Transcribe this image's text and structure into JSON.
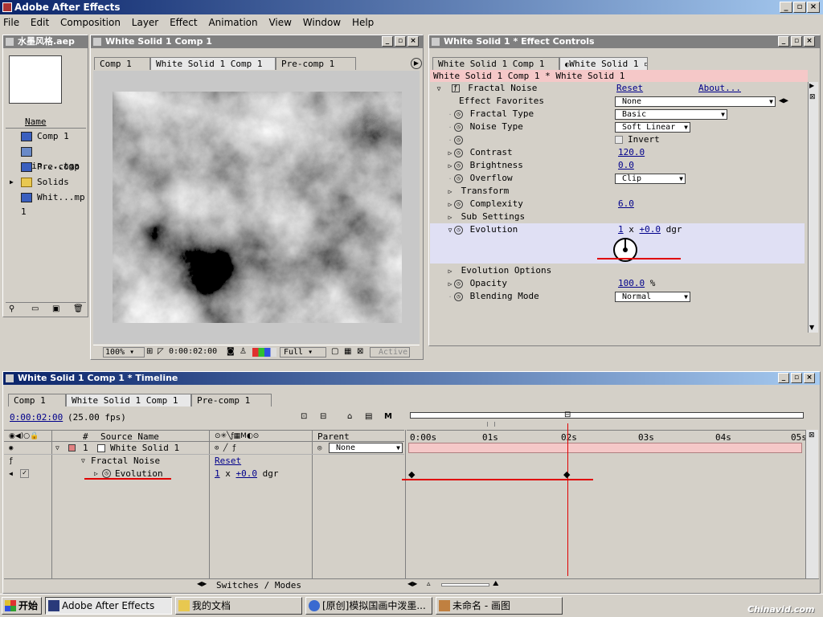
{
  "app": {
    "title": "Adobe After Effects"
  },
  "menu": [
    "File",
    "Edit",
    "Composition",
    "Layer",
    "Effect",
    "Animation",
    "View",
    "Window",
    "Help"
  ],
  "project": {
    "title": "水墨风格.aep",
    "column": "Name",
    "items": [
      {
        "label": "Comp 1",
        "icon": "comp-icon"
      },
      {
        "label": "Pain....tga",
        "icon": "image-icon"
      },
      {
        "label": "Pre-comp 1",
        "icon": "comp-icon"
      },
      {
        "label": "Solids",
        "icon": "folder-icon"
      },
      {
        "label": "Whit...mp 1",
        "icon": "comp-icon"
      }
    ]
  },
  "comp": {
    "title": "White Solid 1 Comp 1",
    "tabs": [
      "Comp 1",
      "White Solid 1 Comp 1",
      "Pre-comp 1"
    ],
    "zoom": "100%",
    "time": "0:00:02:00",
    "resolution": "Full",
    "active": "Active"
  },
  "effects": {
    "title": "White Solid 1 * Effect Controls",
    "tabs": [
      "White Solid 1 Comp 1",
      "White Solid 1"
    ],
    "path": "White Solid 1 Comp 1 * White Solid 1",
    "effect_name": "Fractal Noise",
    "reset": "Reset",
    "about": "About...",
    "rows": {
      "favorites": {
        "label": "Effect Favorites",
        "value": "None"
      },
      "fractal_type": {
        "label": "Fractal Type",
        "value": "Basic"
      },
      "noise_type": {
        "label": "Noise Type",
        "value": "Soft Linear"
      },
      "invert": {
        "label": "Invert"
      },
      "contrast": {
        "label": "Contrast",
        "value": "120.0"
      },
      "brightness": {
        "label": "Brightness",
        "value": "0.0"
      },
      "overflow": {
        "label": "Overflow",
        "value": "Clip"
      },
      "transform": {
        "label": "Transform"
      },
      "complexity": {
        "label": "Complexity",
        "value": "6.0"
      },
      "sub_settings": {
        "label": "Sub Settings"
      },
      "evolution": {
        "label": "Evolution",
        "rev": "1",
        "angle": "+0.0",
        "unit": "dgr"
      },
      "evolution_options": {
        "label": "Evolution Options"
      },
      "opacity": {
        "label": "Opacity",
        "value": "100.0",
        "unit": "%"
      },
      "blending": {
        "label": "Blending Mode",
        "value": "Normal"
      }
    }
  },
  "timeline": {
    "title": "White Solid 1 Comp 1 * Timeline",
    "tabs": [
      "Comp 1",
      "White Solid 1 Comp 1",
      "Pre-comp 1"
    ],
    "time": "0:00:02:00",
    "fps": "(25.00 fps)",
    "columns": {
      "num": "#",
      "source": "Source Name",
      "parent": "Parent"
    },
    "layer": {
      "num": "1",
      "name": "White Solid 1",
      "parent": "None"
    },
    "effect": {
      "name": "Fractal Noise",
      "reset": "Reset"
    },
    "property": {
      "name": "Evolution",
      "rev": "1",
      "angle": "+0.0",
      "unit": "dgr"
    },
    "ruler": [
      "0:00s",
      "01s",
      "02s",
      "03s",
      "04s",
      "05s"
    ],
    "switches": "Switches / Modes"
  },
  "taskbar": {
    "start": "开始",
    "items": [
      "Adobe After Effects",
      "我的文档",
      "[原创]模拟国画中泼墨...",
      "未命名 - 画图"
    ],
    "watermark": "Chinavid.com"
  },
  "colors": {
    "accent": "#0a246a",
    "annotation": "#e00000",
    "highlight": "#f5c8c8"
  }
}
